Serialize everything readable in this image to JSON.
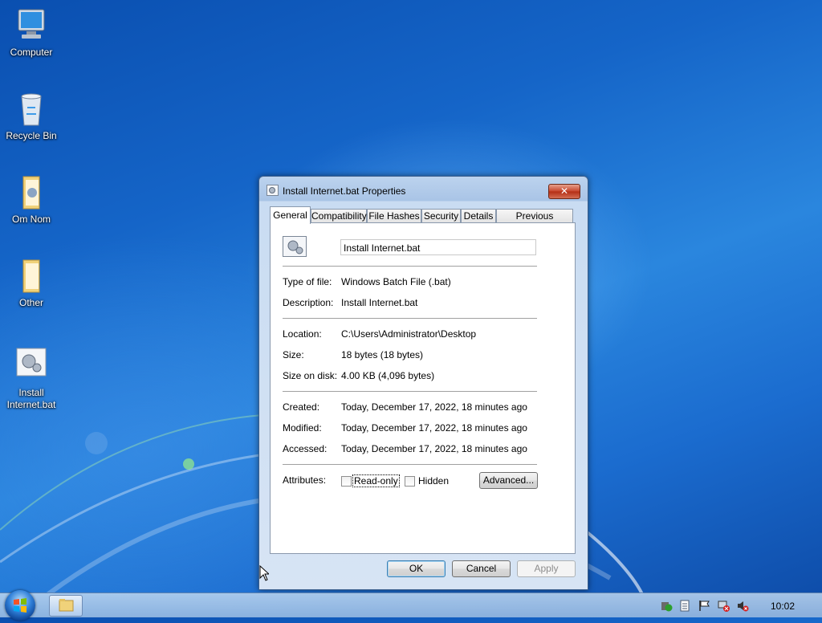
{
  "desktop": {
    "icons": [
      {
        "label": "Computer"
      },
      {
        "label": "Recycle Bin"
      },
      {
        "label": "Om Nom"
      },
      {
        "label": "Other"
      },
      {
        "label": "Install Internet.bat"
      }
    ]
  },
  "window": {
    "title": "Install Internet.bat Properties",
    "close_label": "✕",
    "tabs": [
      {
        "label": "General"
      },
      {
        "label": "Compatibility"
      },
      {
        "label": "File Hashes"
      },
      {
        "label": "Security"
      },
      {
        "label": "Details"
      },
      {
        "label": "Previous Versions"
      }
    ],
    "general": {
      "file_name": "Install Internet.bat",
      "type_label": "Type of file:",
      "type_value": "Windows Batch File (.bat)",
      "description_label": "Description:",
      "description_value": "Install Internet.bat",
      "location_label": "Location:",
      "location_value": "C:\\Users\\Administrator\\Desktop",
      "size_label": "Size:",
      "size_value": "18 bytes (18 bytes)",
      "size_on_disk_label": "Size on disk:",
      "size_on_disk_value": "4.00 KB (4,096 bytes)",
      "created_label": "Created:",
      "created_value": "Today, December 17, 2022, 18 minutes ago",
      "modified_label": "Modified:",
      "modified_value": "Today, December 17, 2022, 18 minutes ago",
      "accessed_label": "Accessed:",
      "accessed_value": "Today, December 17, 2022, 18 minutes ago",
      "attributes_label": "Attributes:",
      "readonly_label": "Read-only",
      "hidden_label": "Hidden",
      "advanced_label": "Advanced..."
    },
    "buttons": {
      "ok": "OK",
      "cancel": "Cancel",
      "apply": "Apply"
    }
  },
  "taskbar": {
    "clock": "10:02"
  }
}
